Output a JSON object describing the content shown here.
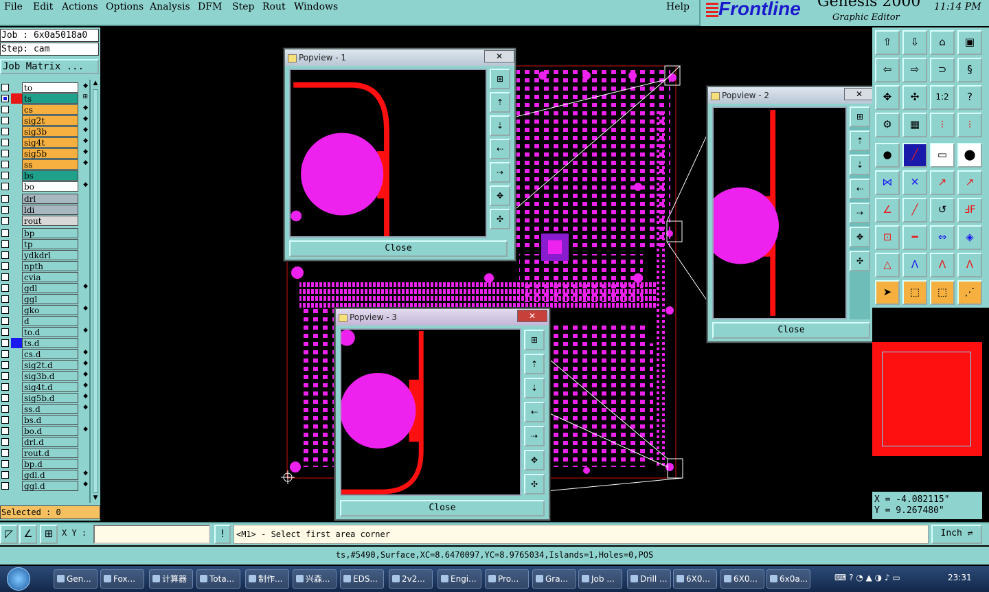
{
  "menu": {
    "items": [
      "File",
      "Edit",
      "Actions",
      "Options",
      "Analysis",
      "DFM",
      "Step",
      "Rout",
      "Windows"
    ],
    "help": "Help"
  },
  "logo": {
    "brand": "Frontline",
    "product": "Genesis 2000",
    "subtitle": "Graphic Editor",
    "time": "11:14 PM"
  },
  "job": {
    "job_label": "Job : 6x0a5018a0",
    "step_label": "Step: cam",
    "matrix_button": "Job Matrix ..."
  },
  "layers": [
    {
      "name": "to",
      "color": "#ffffff",
      "mark": "◆"
    },
    {
      "name": "ts",
      "color": "#1fa08a",
      "mark": "⊞",
      "selected": true,
      "swatch": "#e81818"
    },
    {
      "name": "cs",
      "color": "#f5b040",
      "mark": "◆"
    },
    {
      "name": "sig2t",
      "color": "#f5b040",
      "mark": "◆"
    },
    {
      "name": "sig3b",
      "color": "#f5b040",
      "mark": "◆"
    },
    {
      "name": "sig4t",
      "color": "#f5b040",
      "mark": "◆"
    },
    {
      "name": "sig5b",
      "color": "#f5b040",
      "mark": "◆"
    },
    {
      "name": "ss",
      "color": "#f5b040",
      "mark": "◆"
    },
    {
      "name": "bs",
      "color": "#1fa08a",
      "mark": ""
    },
    {
      "name": "bo",
      "color": "#ffffff",
      "mark": "◆"
    },
    {
      "name": "drl",
      "color": "#a8b8c0",
      "mark": ""
    },
    {
      "name": "ldi",
      "color": "#a8b8c0",
      "mark": ""
    },
    {
      "name": "rout",
      "color": "#d8d8d8",
      "mark": ""
    },
    {
      "name": "bp",
      "color": "#8fd3cf",
      "mark": ""
    },
    {
      "name": "tp",
      "color": "#8fd3cf",
      "mark": ""
    },
    {
      "name": "ydkdrl",
      "color": "#8fd3cf",
      "mark": ""
    },
    {
      "name": "npth",
      "color": "#8fd3cf",
      "mark": ""
    },
    {
      "name": "cvia",
      "color": "#8fd3cf",
      "mark": ""
    },
    {
      "name": "gdl",
      "color": "#8fd3cf",
      "mark": "◆"
    },
    {
      "name": "ggl",
      "color": "#8fd3cf",
      "mark": ""
    },
    {
      "name": "gko",
      "color": "#8fd3cf",
      "mark": "◆"
    },
    {
      "name": "d",
      "color": "#8fd3cf",
      "mark": ""
    },
    {
      "name": "to.d",
      "color": "#8fd3cf",
      "mark": "◆"
    },
    {
      "name": "ts.d",
      "color": "#8fd3cf",
      "mark": "",
      "swatch": "#1a1aee"
    },
    {
      "name": "cs.d",
      "color": "#8fd3cf",
      "mark": "◆"
    },
    {
      "name": "sig2t.d",
      "color": "#8fd3cf",
      "mark": "◆"
    },
    {
      "name": "sig3b.d",
      "color": "#8fd3cf",
      "mark": "◆"
    },
    {
      "name": "sig4t.d",
      "color": "#8fd3cf",
      "mark": "◆"
    },
    {
      "name": "sig5b.d",
      "color": "#8fd3cf",
      "mark": "◆"
    },
    {
      "name": "ss.d",
      "color": "#8fd3cf",
      "mark": "◆"
    },
    {
      "name": "bs.d",
      "color": "#8fd3cf",
      "mark": ""
    },
    {
      "name": "bo.d",
      "color": "#8fd3cf",
      "mark": "◆"
    },
    {
      "name": "drl.d",
      "color": "#8fd3cf",
      "mark": ""
    },
    {
      "name": "rout.d",
      "color": "#8fd3cf",
      "mark": ""
    },
    {
      "name": "bp.d",
      "color": "#8fd3cf",
      "mark": ""
    },
    {
      "name": "gdl.d",
      "color": "#8fd3cf",
      "mark": "◆"
    },
    {
      "name": "ggl.d",
      "color": "#8fd3cf",
      "mark": "◆"
    }
  ],
  "selected_label": "Selected : 0",
  "popviews": [
    {
      "title": "Popview - 1",
      "close": "Close"
    },
    {
      "title": "Popview - 2",
      "close": "Close"
    },
    {
      "title": "Popview - 3",
      "close": "Close"
    }
  ],
  "coords": {
    "x": "X = -4.082115\"",
    "y": "Y = 9.267480\""
  },
  "command": {
    "xy_label": "X Y :",
    "xy_value": "",
    "prompt": "<M1> - Select first area corner",
    "units": "Inch"
  },
  "status": "ts,#5490,Surface,XC=8.6470097,YC=8.9765034,Islands=1,Holes=0,POS",
  "taskbar": {
    "items": [
      "Gen...",
      "Fox...",
      "计算器",
      "Tota...",
      "制作...",
      "兴森...",
      "EDS...",
      "2v2...",
      "Engi...",
      "Pro...",
      "Gra...",
      "Job ...",
      "Drill ...",
      "6X0...",
      "6X0...",
      "6x0a..."
    ],
    "clock": "23:31"
  },
  "colors": {
    "panel": "#8fd3cf",
    "copper": "#ee22ee",
    "trace": "#ff1010",
    "highlight": "#f5b040"
  }
}
